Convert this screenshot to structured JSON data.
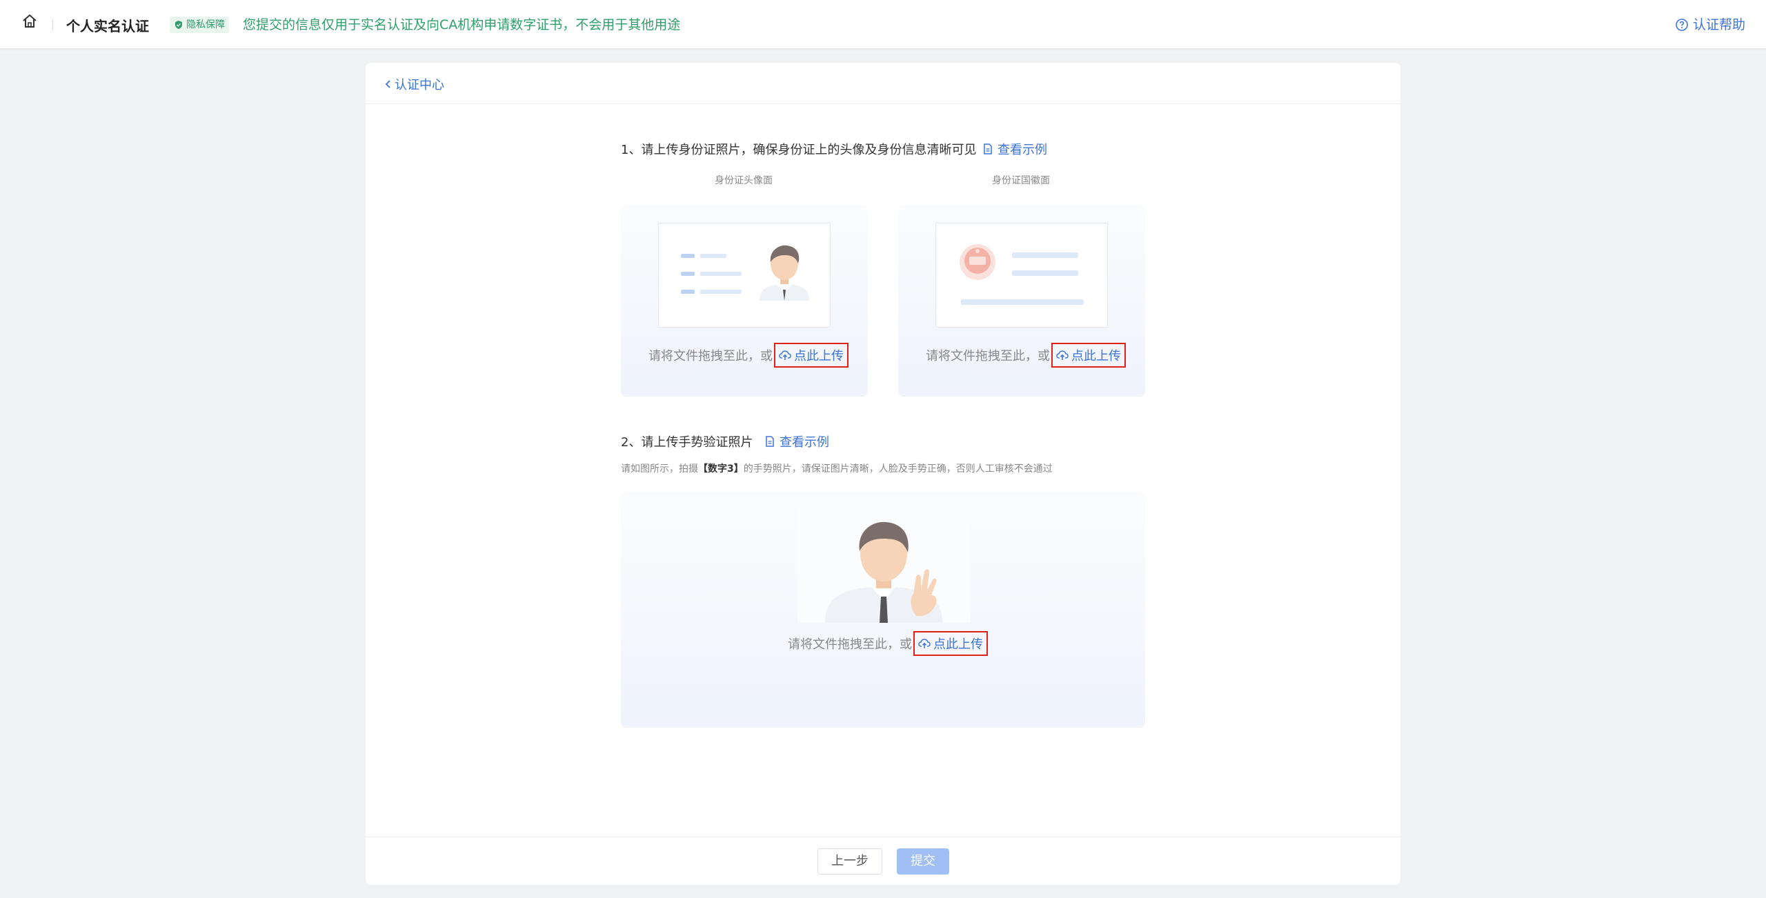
{
  "header": {
    "title": "个人实名认证",
    "privacy_badge": "隐私保障",
    "privacy_notice": "您提交的信息仅用于实名认证及向CA机构申请数字证书，不会用于其他用途",
    "help_label": "认证帮助"
  },
  "nav": {
    "back_label": "认证中心"
  },
  "section1": {
    "title": "1、请上传身份证照片，确保身份证上的头像及身份信息清晰可见",
    "example_label": "查看示例",
    "front": {
      "label": "身份证头像面",
      "drop_text": "请将文件拖拽至此，或",
      "upload_label": "点此上传"
    },
    "back": {
      "label": "身份证国徽面",
      "drop_text": "请将文件拖拽至此，或",
      "upload_label": "点此上传"
    }
  },
  "section2": {
    "title": "2、请上传手势验证照片",
    "example_label": "查看示例",
    "hint_prefix": "请如图所示，拍摄",
    "hint_bold": "【数字3】",
    "hint_suffix": "的手势照片，请保证图片清晰，人脸及手势正确，否则人工审核不会通过",
    "drop_text": "请将文件拖拽至此，或",
    "upload_label": "点此上传"
  },
  "footer": {
    "prev_label": "上一步",
    "submit_label": "提交"
  },
  "colors": {
    "accent": "#3b73d9",
    "privacy_green": "#2f9e6a",
    "highlight_red": "#e0201a",
    "submit_disabled": "#9fbff5"
  }
}
